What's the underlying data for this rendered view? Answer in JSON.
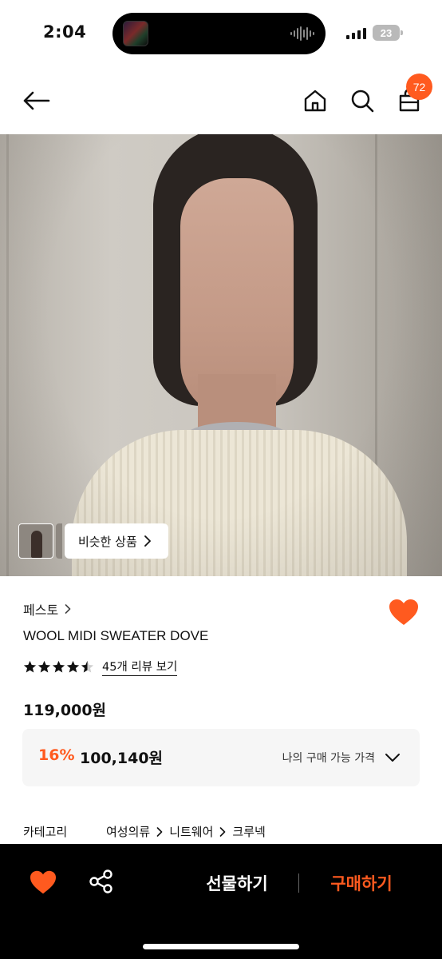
{
  "status_bar": {
    "time": "2:04",
    "battery": "23"
  },
  "header": {
    "cart_count": "72"
  },
  "hero": {
    "similar_products_label": "비슷한 상품"
  },
  "product": {
    "brand": "페스토",
    "name": "WOOL MIDI SWEATER DOVE",
    "rating": 4.5,
    "review_link": "45개 리뷰 보기",
    "price": "119,000원",
    "discount": "16%",
    "member_price": "100,140원",
    "my_price_label": "나의 구매 가능 가격",
    "category_label": "카테고리",
    "category_path": [
      "여성의류",
      "니트웨어",
      "크루넥"
    ]
  },
  "bottom_bar": {
    "gift_label": "선물하기",
    "buy_label": "구매하기"
  },
  "colors": {
    "accent": "#ff5a1f",
    "bottom_bar": "#000000",
    "price_box": "#f6f6f6"
  }
}
